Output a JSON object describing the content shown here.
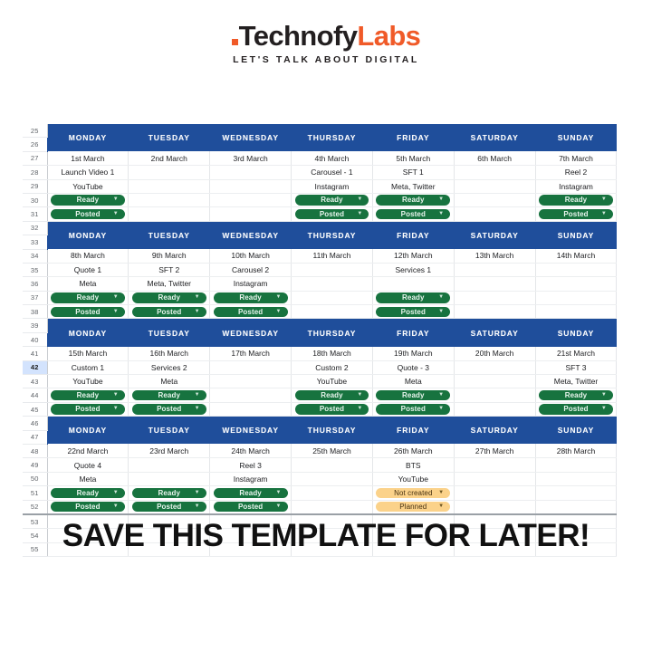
{
  "logo": {
    "dot": "square-dot",
    "name_part1": "Techno",
    "name_part2": "fy",
    "name_part3": "Labs",
    "tagline": "LET'S TALK ABOUT DIGITAL",
    "dark_color": "#231F20",
    "accent_color": "#F05A28"
  },
  "colors": {
    "header_blue": "#1F4E9B",
    "chip_green": "#17733F",
    "chip_yellow": "#FBD28A",
    "row_selected": "#D3E3FD"
  },
  "spreadsheet": {
    "day_headers": [
      "MONDAY",
      "TUESDAY",
      "WEDNESDAY",
      "THURSDAY",
      "FRIDAY",
      "SATURDAY",
      "SUNDAY"
    ],
    "selected_row": "42",
    "row_numbers": [
      "25",
      "26",
      "27",
      "28",
      "29",
      "30",
      "31",
      "32",
      "33",
      "34",
      "35",
      "36",
      "37",
      "38",
      "39",
      "40",
      "41",
      "42",
      "43",
      "44",
      "45",
      "46",
      "47",
      "48",
      "49",
      "50",
      "51",
      "52",
      "53",
      "54",
      "55"
    ],
    "weeks": [
      {
        "header_rows": [
          "25",
          "26"
        ],
        "rows": [
          {
            "num": "27",
            "type": "date",
            "cells": [
              "1st March",
              "2nd March",
              "3rd March",
              "4th March",
              "5th March",
              "6th March",
              "7th March"
            ]
          },
          {
            "num": "28",
            "type": "text",
            "cells": [
              "Launch Video 1",
              "",
              "",
              "Carousel - 1",
              "SFT 1",
              "",
              "Reel 2"
            ]
          },
          {
            "num": "29",
            "type": "text",
            "cells": [
              "YouTube",
              "",
              "",
              "Instagram",
              "Meta, Twitter",
              "",
              "Instagram"
            ]
          },
          {
            "num": "30",
            "type": "status",
            "cells": [
              "Ready",
              "",
              "",
              "Ready",
              "Ready",
              "",
              "Ready"
            ]
          },
          {
            "num": "31",
            "type": "status",
            "cells": [
              "Posted",
              "",
              "",
              "Posted",
              "Posted",
              "",
              "Posted"
            ]
          }
        ]
      },
      {
        "header_rows": [
          "32",
          "33"
        ],
        "rows": [
          {
            "num": "34",
            "type": "date",
            "cells": [
              "8th March",
              "9th March",
              "10th March",
              "11th March",
              "12th March",
              "13th March",
              "14th March"
            ]
          },
          {
            "num": "35",
            "type": "text",
            "cells": [
              "Quote 1",
              "SFT 2",
              "Carousel 2",
              "",
              "Services 1",
              "",
              ""
            ]
          },
          {
            "num": "36",
            "type": "text",
            "cells": [
              "Meta",
              "Meta, Twitter",
              "Instagram",
              "",
              "",
              "",
              ""
            ]
          },
          {
            "num": "37",
            "type": "status",
            "cells": [
              "Ready",
              "Ready",
              "Ready",
              "",
              "Ready",
              "",
              ""
            ]
          },
          {
            "num": "38",
            "type": "status",
            "cells": [
              "Posted",
              "Posted",
              "Posted",
              "",
              "Posted",
              "",
              ""
            ]
          }
        ]
      },
      {
        "header_rows": [
          "39",
          "40"
        ],
        "rows": [
          {
            "num": "41",
            "type": "date",
            "cells": [
              "15th March",
              "16th March",
              "17th March",
              "18th March",
              "19th March",
              "20th March",
              "21st March"
            ]
          },
          {
            "num": "42",
            "type": "text",
            "cells": [
              "Custom 1",
              "Services 2",
              "",
              "Custom 2",
              "Quote - 3",
              "",
              "SFT 3"
            ]
          },
          {
            "num": "43",
            "type": "text",
            "cells": [
              "YouTube",
              "Meta",
              "",
              "YouTube",
              "Meta",
              "",
              "Meta, Twitter"
            ]
          },
          {
            "num": "44",
            "type": "status",
            "cells": [
              "Ready",
              "Ready",
              "",
              "Ready",
              "Ready",
              "",
              "Ready"
            ]
          },
          {
            "num": "45",
            "type": "status",
            "cells": [
              "Posted",
              "Posted",
              "",
              "Posted",
              "Posted",
              "",
              "Posted"
            ]
          }
        ]
      },
      {
        "header_rows": [
          "46",
          "47"
        ],
        "rows": [
          {
            "num": "48",
            "type": "date",
            "cells": [
              "22nd March",
              "23rd March",
              "24th March",
              "25th March",
              "26th March",
              "27th March",
              "28th March"
            ]
          },
          {
            "num": "49",
            "type": "text",
            "cells": [
              "Quote 4",
              "",
              "Reel 3",
              "",
              "BTS",
              "",
              ""
            ]
          },
          {
            "num": "50",
            "type": "text",
            "cells": [
              "Meta",
              "",
              "Instagram",
              "",
              "YouTube",
              "",
              ""
            ]
          },
          {
            "num": "51",
            "type": "status",
            "cells": [
              "Ready",
              "Ready",
              "Ready",
              "",
              "Not created",
              "",
              ""
            ]
          },
          {
            "num": "52",
            "type": "status",
            "cells": [
              "Posted",
              "Posted",
              "Posted",
              "",
              "Planned",
              "",
              ""
            ]
          }
        ]
      }
    ],
    "empty_rows": [
      "53",
      "54",
      "55"
    ],
    "status_styles": {
      "Ready": "green",
      "Posted": "green",
      "Not created": "yellow",
      "Planned": "yellow"
    },
    "dropdown_arrow": "▼"
  },
  "banner": {
    "text": "SAVE THIS TEMPLATE FOR LATER!"
  }
}
